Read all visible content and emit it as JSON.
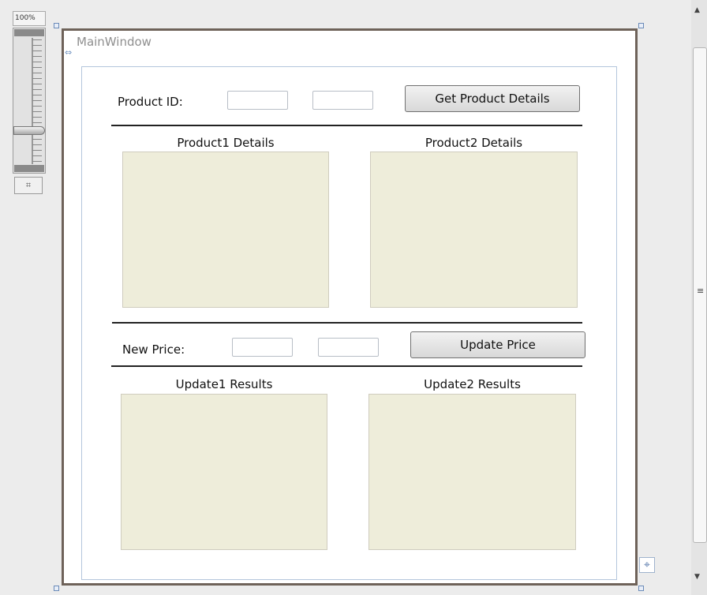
{
  "zoom": {
    "level": "100%",
    "fit_icon": "fit-to-screen-icon"
  },
  "window": {
    "title": "MainWindow"
  },
  "product_row": {
    "label": "Product ID:",
    "input1_value": "",
    "input2_value": "",
    "button": "Get Product Details"
  },
  "product_panels": {
    "left_title": "Product1 Details",
    "right_title": "Product2 Details"
  },
  "price_row": {
    "label": "New Price:",
    "input1_value": "",
    "input2_value": "",
    "button": "Update Price"
  },
  "update_panels": {
    "left_title": "Update1 Results",
    "right_title": "Update2 Results"
  },
  "colors": {
    "panel": "#eeedda",
    "window_border": "#6e6259",
    "selection": "#6b8bb8"
  },
  "scrollbar": {
    "up_icon": "arrow-up-icon",
    "down_icon": "arrow-down-icon"
  }
}
